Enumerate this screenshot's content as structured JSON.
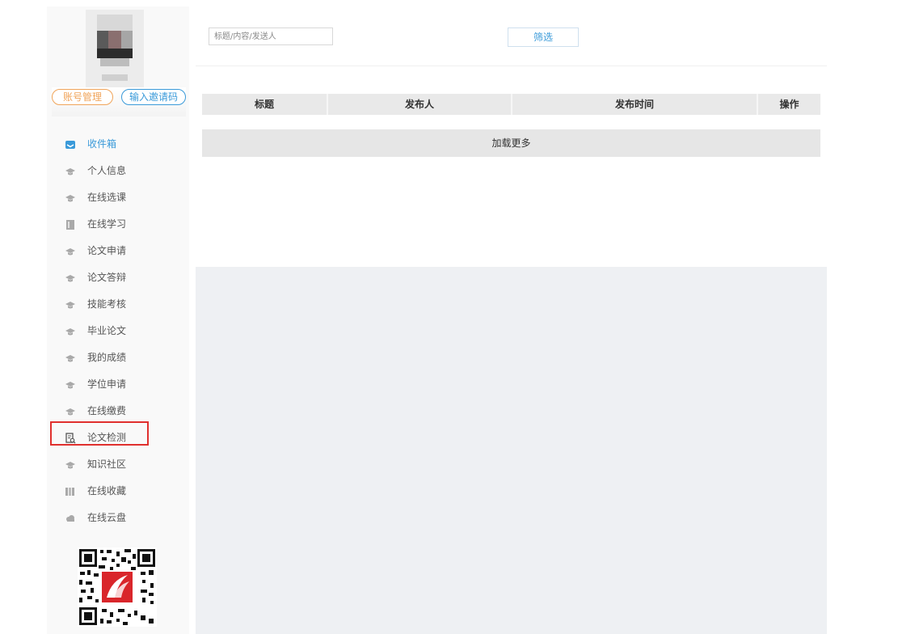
{
  "sidebar": {
    "account_button": "账号管理",
    "invite_button": "输入邀请码",
    "items": [
      {
        "label": "收件箱",
        "icon": "inbox-icon",
        "active": true
      },
      {
        "label": "个人信息",
        "icon": "graduation-cap-icon"
      },
      {
        "label": "在线选课",
        "icon": "graduation-cap-icon"
      },
      {
        "label": "在线学习",
        "icon": "book-icon"
      },
      {
        "label": "论文申请",
        "icon": "graduation-cap-icon"
      },
      {
        "label": "论文答辩",
        "icon": "graduation-cap-icon"
      },
      {
        "label": "技能考核",
        "icon": "graduation-cap-icon"
      },
      {
        "label": "毕业论文",
        "icon": "graduation-cap-icon"
      },
      {
        "label": "我的成绩",
        "icon": "graduation-cap-icon"
      },
      {
        "label": "学位申请",
        "icon": "graduation-cap-icon"
      },
      {
        "label": "在线缴费",
        "icon": "graduation-cap-icon"
      },
      {
        "label": "论文检测",
        "icon": "document-search-icon",
        "highlighted": true
      },
      {
        "label": "知识社区",
        "icon": "graduation-cap-icon"
      },
      {
        "label": "在线收藏",
        "icon": "books-icon"
      },
      {
        "label": "在线云盘",
        "icon": "cloud-icon"
      }
    ]
  },
  "toolbar": {
    "search_placeholder": "标题/内容/发送人",
    "filter_label": "筛选"
  },
  "table": {
    "columns": [
      "标题",
      "发布人",
      "发布时间",
      "操作"
    ],
    "rows": [],
    "load_more": "加载更多"
  },
  "colors": {
    "accent": "#3a9ad9",
    "account_button": "#f0a45a",
    "highlight_border": "#e0302e"
  }
}
